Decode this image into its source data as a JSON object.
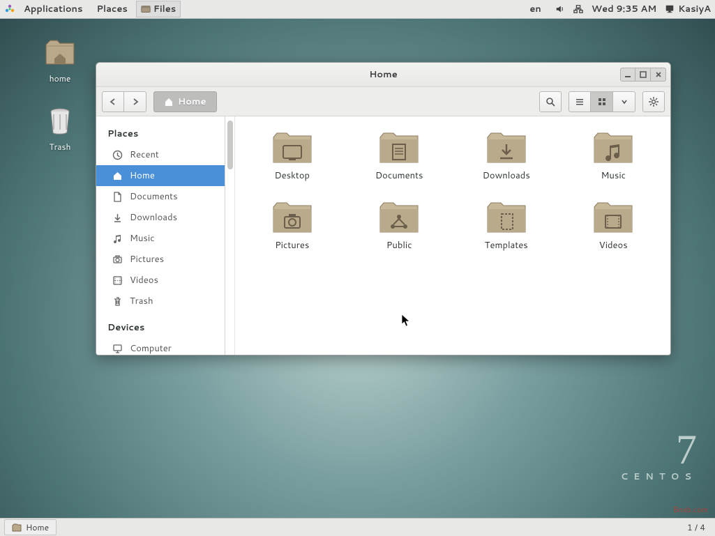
{
  "panel": {
    "apps_menu": "Applications",
    "places_menu": "Places",
    "running_app": "Files",
    "lang": "en",
    "clock": "Wed  9:35 AM",
    "user": "KasiyA"
  },
  "desktop": {
    "home_label": "home",
    "trash_label": "Trash"
  },
  "window": {
    "title": "Home",
    "path_label": "Home",
    "sidebar": {
      "places_title": "Places",
      "devices_title": "Devices",
      "items": [
        {
          "label": "Recent",
          "icon": "clock"
        },
        {
          "label": "Home",
          "icon": "home"
        },
        {
          "label": "Documents",
          "icon": "document"
        },
        {
          "label": "Downloads",
          "icon": "download"
        },
        {
          "label": "Music",
          "icon": "music"
        },
        {
          "label": "Pictures",
          "icon": "camera"
        },
        {
          "label": "Videos",
          "icon": "video"
        },
        {
          "label": "Trash",
          "icon": "trash"
        }
      ],
      "devices": [
        {
          "label": "Computer",
          "icon": "computer"
        }
      ]
    },
    "files": [
      {
        "label": "Desktop",
        "glyph": "desktop"
      },
      {
        "label": "Documents",
        "glyph": "documents"
      },
      {
        "label": "Downloads",
        "glyph": "downloads"
      },
      {
        "label": "Music",
        "glyph": "music"
      },
      {
        "label": "Pictures",
        "glyph": "pictures"
      },
      {
        "label": "Public",
        "glyph": "public"
      },
      {
        "label": "Templates",
        "glyph": "templates"
      },
      {
        "label": "Videos",
        "glyph": "videos"
      }
    ]
  },
  "branding": {
    "version": "7",
    "distro": "CENTOS",
    "watermark": "Bnxb.com"
  },
  "bottom": {
    "task": "Home",
    "workspace": "1 / 4"
  }
}
